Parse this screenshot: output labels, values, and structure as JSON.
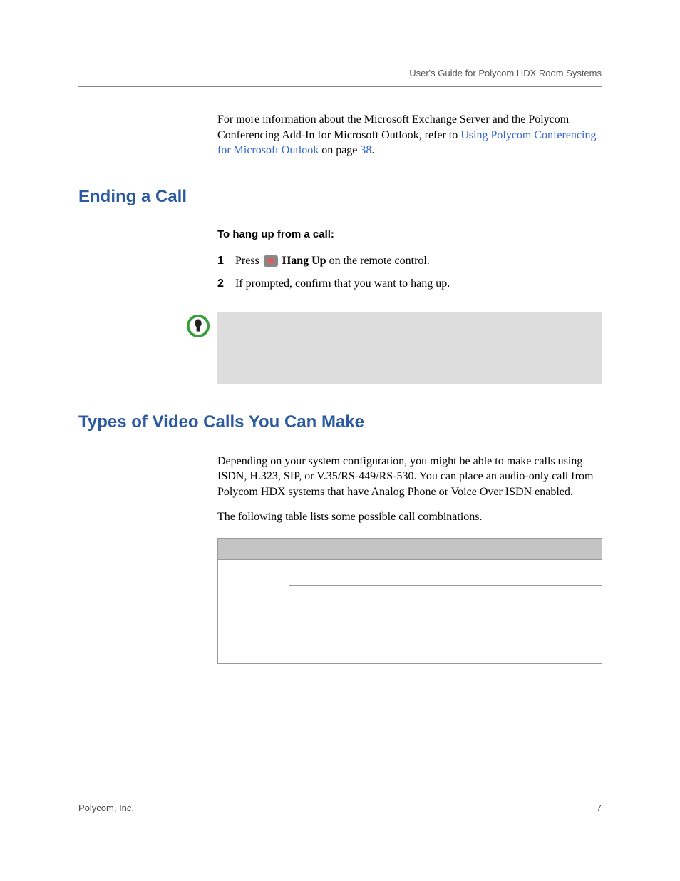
{
  "header": {
    "title": "User's Guide for Polycom HDX Room Systems"
  },
  "intro": {
    "text_before_link": "For more information about the Microsoft Exchange Server and the Polycom Conferencing Add-In for Microsoft Outlook, refer to ",
    "link_text": "Using Polycom Conferencing for Microsoft Outlook",
    "text_mid": " on page ",
    "page_ref": "38",
    "text_end": "."
  },
  "ending_call": {
    "heading": "Ending a Call",
    "procedure_title": "To hang up from a call:",
    "steps": [
      {
        "num": "1",
        "pre": "Press ",
        "bold": "Hang Up",
        "post": " on the remote control."
      },
      {
        "num": "2",
        "text": "If prompted, confirm that you want to hang up."
      }
    ]
  },
  "types": {
    "heading": "Types of Video Calls You Can Make",
    "para1": "Depending on your system configuration, you might be able to make calls using ISDN, H.323, SIP, or V.35/RS-449/RS-530. You can place an audio-only call from Polycom HDX systems that have Analog Phone or Voice Over ISDN enabled.",
    "para2": "The following table lists some possible call combinations."
  },
  "footer": {
    "company": "Polycom, Inc.",
    "page": "7"
  }
}
